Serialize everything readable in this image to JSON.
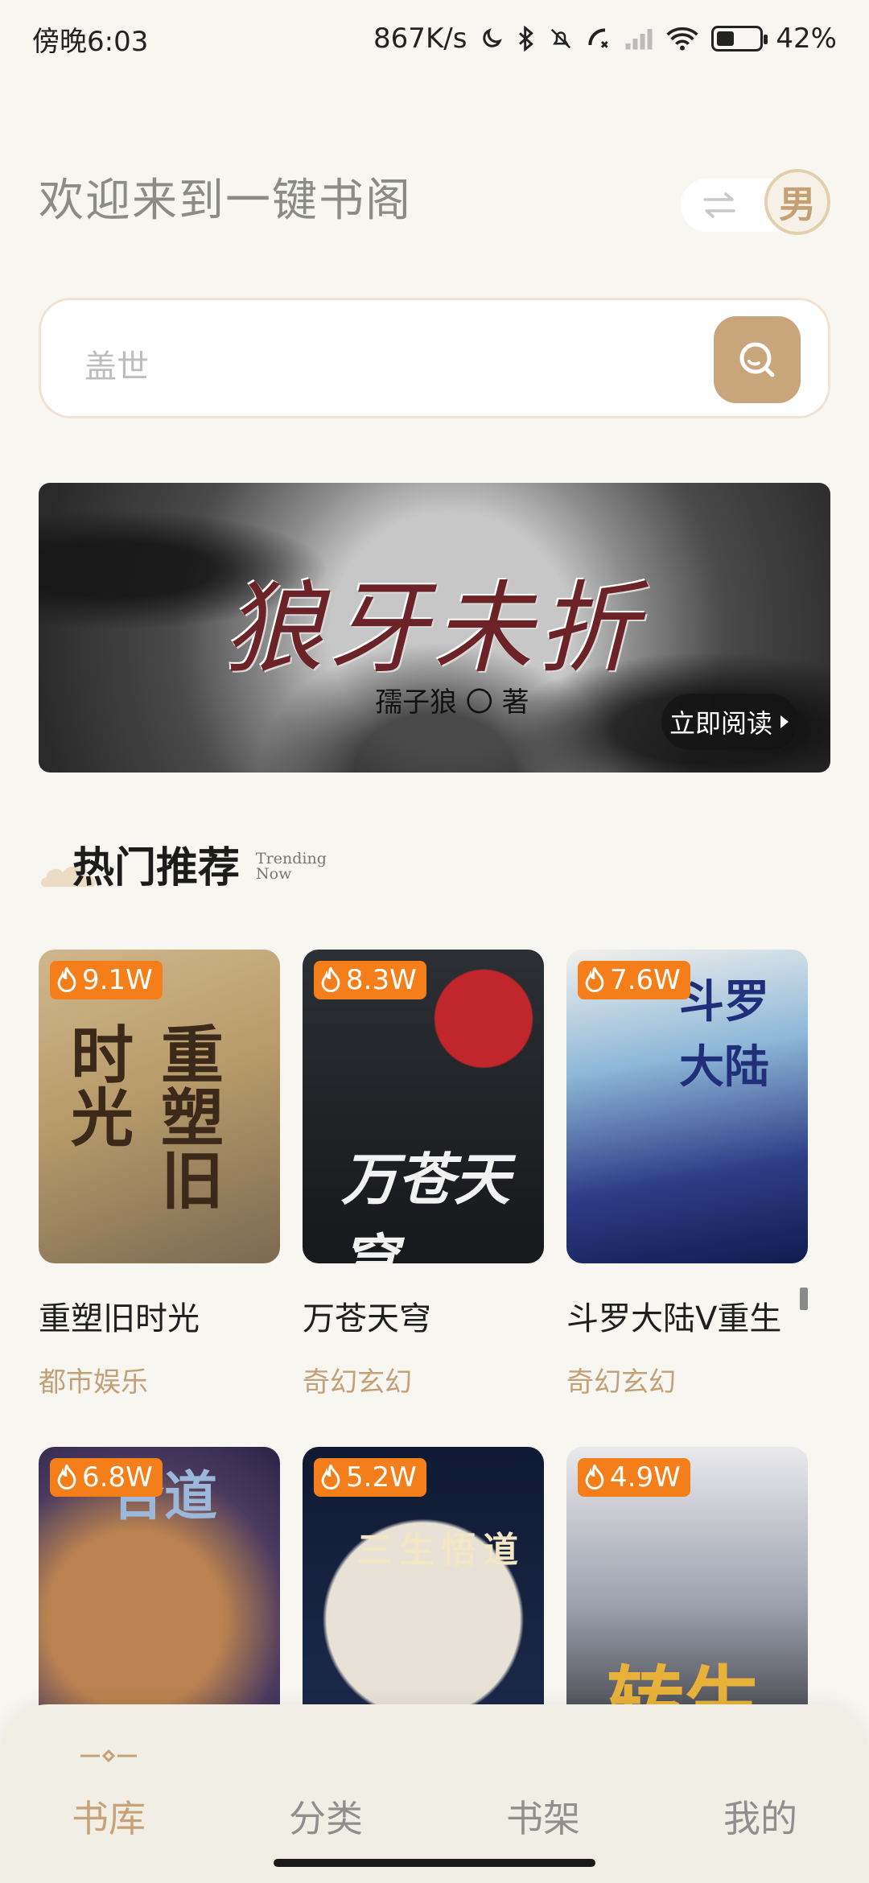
{
  "status_bar": {
    "time": "傍晚6:03",
    "net_speed": "867K/s",
    "battery_percent": "42%",
    "battery_level": 0.42
  },
  "header": {
    "welcome": "欢迎来到一键书阁",
    "gender_label": "男"
  },
  "search": {
    "placeholder": "盖世"
  },
  "banner": {
    "title": "狼牙未折",
    "author": "孺子狼 〇 著",
    "read_label": "立即阅读"
  },
  "section": {
    "title": "热门推荐",
    "subtitle_line1": "Trending",
    "subtitle_line2": "Now"
  },
  "books": [
    {
      "title": "重塑旧时光",
      "category": "都市娱乐",
      "heat": "9.1W",
      "cover_text": "重塑旧时光"
    },
    {
      "title": "万苍天穹",
      "category": "奇幻玄幻",
      "heat": "8.3W",
      "cover_text": "万苍天穹"
    },
    {
      "title": "斗罗大陆V重生",
      "category": "奇幻玄幻",
      "heat": "7.6W",
      "cover_text": "斗罗大陆"
    },
    {
      "title": "",
      "category": "",
      "heat": "6.8W",
      "cover_text": "合道"
    },
    {
      "title": "",
      "category": "",
      "heat": "5.2W",
      "cover_text": "三生悟道"
    },
    {
      "title": "",
      "category": "",
      "heat": "4.9W",
      "cover_text": "转生"
    }
  ],
  "nav": {
    "items": [
      "书库",
      "分类",
      "书架",
      "我的"
    ],
    "active": "书库"
  },
  "colors": {
    "accent": "#c6a276",
    "heat_badge": "#f47f1a",
    "search_button": "#c8a57b"
  }
}
